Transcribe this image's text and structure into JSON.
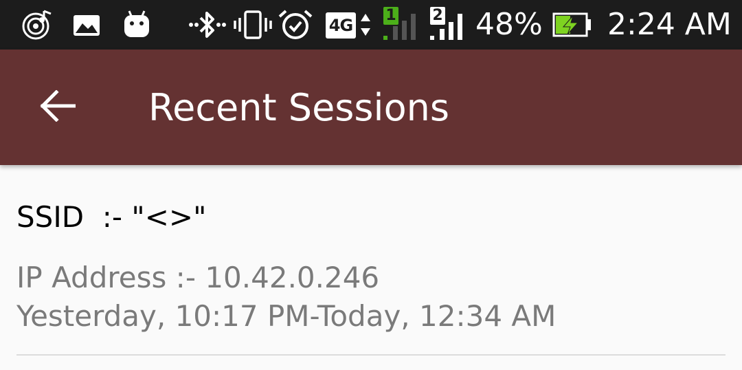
{
  "status_bar": {
    "network_type": "4G",
    "sim1_label": "1",
    "sim2_label": "2",
    "battery_percent": "48%",
    "battery_level": 0.48,
    "battery_charging": true,
    "time": "2:24 AM",
    "colors": {
      "background": "#1c1c1c",
      "sim1_accent": "#4caf1a",
      "battery_accent": "#7ed321"
    },
    "icons": [
      "music-icon",
      "image-icon",
      "android-icon",
      "bluetooth-icon",
      "vibrate-icon",
      "alarm-icon",
      "data-arrows-icon",
      "signal-sim1-icon",
      "signal-sim2-icon",
      "battery-charging-icon"
    ]
  },
  "app_bar": {
    "back_icon": "arrow-left-icon",
    "title": "Recent Sessions",
    "color": "#643232"
  },
  "sessions": [
    {
      "ssid": "SSID  :- \"<>\"",
      "ip": "IP Address :- 10.42.0.246",
      "time_range": "Yesterday, 10:17 PM-Today, 12:34 AM"
    }
  ]
}
